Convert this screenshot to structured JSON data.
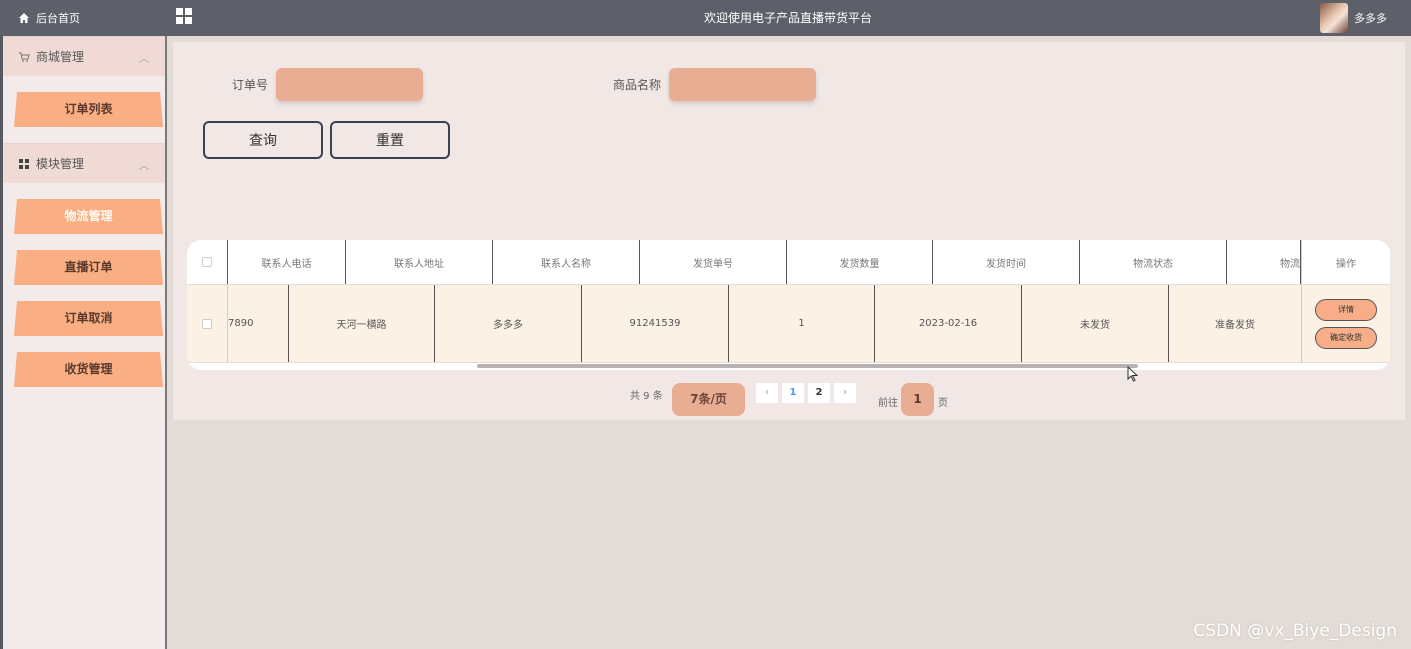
{
  "header": {
    "home_label": "后台首页",
    "title": "欢迎使用电子产品直播带货平台",
    "username": "多多多"
  },
  "sidebar": {
    "groups": [
      {
        "label": "商城管理",
        "icon": "cart-icon",
        "items": [
          {
            "label": "订单列表"
          }
        ]
      },
      {
        "label": "模块管理",
        "icon": "grid-icon",
        "items": [
          {
            "label": "物流管理"
          },
          {
            "label": "直播订单"
          },
          {
            "label": "订单取消"
          },
          {
            "label": "收货管理"
          }
        ]
      }
    ]
  },
  "search": {
    "order_no_label": "订单号",
    "order_no_value": "",
    "product_label": "商品名称",
    "product_value": "",
    "query_button": "查询",
    "reset_button": "重置"
  },
  "table": {
    "columns": [
      "联系人电话",
      "联系人地址",
      "联系人名称",
      "发货单号",
      "发货数量",
      "发货时间",
      "物流状态",
      "物流"
    ],
    "action_header": "操作",
    "rows": [
      {
        "phone": "7890",
        "address": "天河一横路",
        "contact": "多多多",
        "shipping_no": "91241539",
        "quantity": "1",
        "ship_time": "2023-02-16",
        "logistics_status": "未发货",
        "logistics": "准备发货",
        "actions": [
          "详情",
          "确定收货"
        ]
      }
    ]
  },
  "pagination": {
    "total_text": "共 9 条",
    "page_size": "7条/页",
    "prev": "‹",
    "next": "›",
    "pages": [
      "1",
      "2"
    ],
    "current_page": "1",
    "goto_label": "前往",
    "goto_value": "1",
    "goto_unit": "页"
  },
  "watermark": "CSDN @vx_Biye_Design",
  "colors": {
    "topbar": "#5e6069",
    "accent": "#f9ae84",
    "input_bg": "#e9ad94",
    "panel": "#f1e7e5"
  }
}
